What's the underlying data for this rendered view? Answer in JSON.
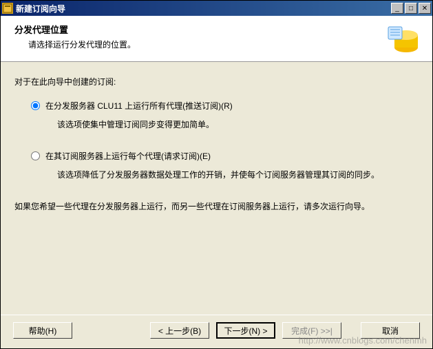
{
  "window": {
    "title": "新建订阅向导"
  },
  "header": {
    "title": "分发代理位置",
    "subtitle": "请选择运行分发代理的位置。"
  },
  "content": {
    "intro": "对于在此向导中创建的订阅:",
    "option1": {
      "label": "在分发服务器 CLU11 上运行所有代理(推送订阅)(R)",
      "desc": "该选项使集中管理订阅同步变得更加简单。",
      "selected": true
    },
    "option2": {
      "label": "在其订阅服务器上运行每个代理(请求订阅)(E)",
      "desc": "该选项降低了分发服务器数据处理工作的开销，并使每个订阅服务器管理其订阅的同步。",
      "selected": false
    },
    "footer_note": "如果您希望一些代理在分发服务器上运行，而另一些代理在订阅服务器上运行，请多次运行向导。"
  },
  "buttons": {
    "help": "帮助(H)",
    "back": "< 上一步(B)",
    "next": "下一步(N) >",
    "finish": "完成(F) >>|",
    "cancel": "取消"
  },
  "watermark": "http://www.cnblogs.com/chenmh"
}
